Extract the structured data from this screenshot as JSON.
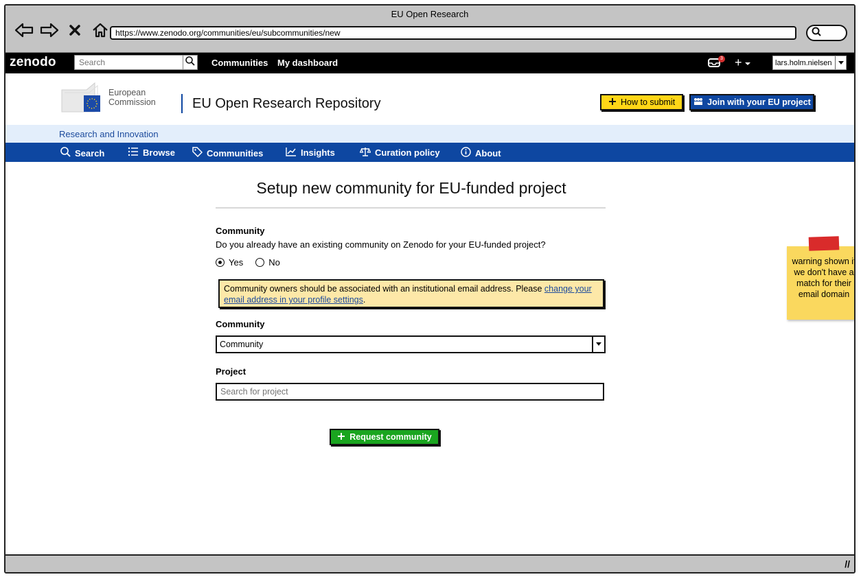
{
  "window": {
    "title": "EU Open Research",
    "url": "https://www.zenodo.org/communities/eu/subcommunities/new"
  },
  "topbar": {
    "logo": "zenodo",
    "search_placeholder": "Search",
    "links": [
      "Communities",
      "My dashboard"
    ],
    "inbox_count": "3",
    "plus_label": "+",
    "username": "lars.holm.nielsen"
  },
  "eu_header": {
    "org_line1": "European",
    "org_line2": "Commission",
    "repo_title": "EU Open Research Repository",
    "how_to_submit": "How to submit",
    "join_project": "Join with your EU project",
    "subtitle": "Research and Innovation"
  },
  "main_nav": {
    "items": [
      {
        "label": "Search",
        "icon": "search-icon"
      },
      {
        "label": "Browse",
        "icon": "list-icon"
      },
      {
        "label": "Communities",
        "icon": "tag-icon"
      },
      {
        "label": "Insights",
        "icon": "chart-icon"
      },
      {
        "label": "Curation policy",
        "icon": "scales-icon"
      },
      {
        "label": "About",
        "icon": "info-icon"
      }
    ]
  },
  "form": {
    "title": "Setup new community for EU-funded project",
    "community_section_label": "Community",
    "question": "Do you already have an existing community on Zenodo for your EU-funded project?",
    "radio_yes": "Yes",
    "radio_no": "No",
    "selected": "Yes",
    "warning_text": "Community owners should be associated with an institutional email address. Please ",
    "warning_link": "change your email address in your profile settings",
    "warning_end": ".",
    "community_label": "Community",
    "community_value": "Community",
    "project_label": "Project",
    "project_placeholder": "Search for project",
    "submit_label": "Request community"
  },
  "sticky_note": "warning shown if we don't have a match for their email domain",
  "colors": {
    "eu_blue": "#0e47a1",
    "zenodo_black": "#000000",
    "accent_yellow": "#ffd617",
    "success_green": "#1aa51f",
    "warning_bg": "#fde8a8"
  }
}
